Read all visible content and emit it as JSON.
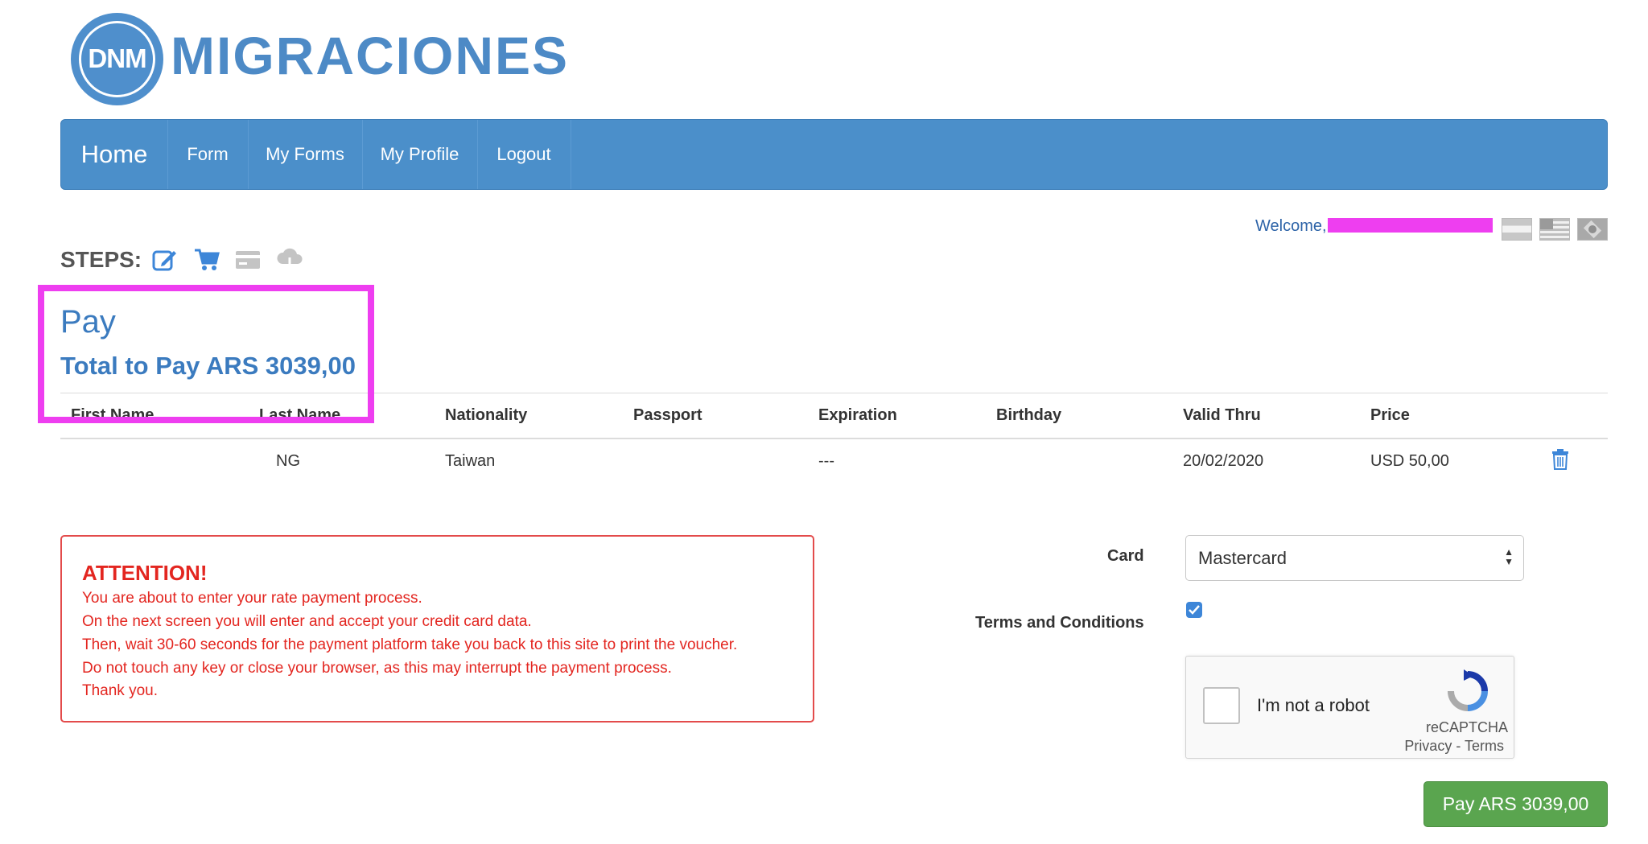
{
  "logo": {
    "abbr": "DNM",
    "name": "MIGRACIONES"
  },
  "nav": {
    "home": "Home",
    "form": "Form",
    "my_forms": "My Forms",
    "my_profile": "My Profile",
    "logout": "Logout"
  },
  "header": {
    "welcome": "Welcome,"
  },
  "steps": {
    "label": "STEPS:",
    "icons": [
      "edit-icon",
      "cart-icon",
      "credit-card-icon",
      "cloud-download-icon"
    ]
  },
  "pay": {
    "title": "Pay",
    "total": "Total to Pay ARS 3039,00"
  },
  "table": {
    "headers": [
      "First Name",
      "Last Name",
      "Nationality",
      "Passport",
      "Expiration",
      "Birthday",
      "Valid Thru",
      "Price"
    ],
    "row": {
      "first_name": "",
      "last_name": "NG",
      "nationality": "Taiwan",
      "passport": "",
      "expiration": "---",
      "birthday": "",
      "valid_thru": "20/02/2020",
      "price": "USD 50,00"
    }
  },
  "attention": {
    "title": "ATTENTION!",
    "lines": [
      "You are about to enter your rate payment process.",
      "On the next screen you will enter and accept your credit card data.",
      "Then, wait 30-60 seconds for the payment platform take you back to this site to print the voucher.",
      "Do not touch any key or close your browser, as this may interrupt the payment process.",
      "Thank you."
    ]
  },
  "form": {
    "card_label": "Card",
    "card_value": "Mastercard",
    "terms_label": "Terms and Conditions",
    "terms_checked": true
  },
  "captcha": {
    "text": "I'm not a robot",
    "brand": "reCAPTCHA",
    "links": "Privacy - Terms"
  },
  "pay_button": "Pay ARS 3039,00",
  "colors": {
    "nav": "#4b8fca",
    "title": "#3b7bbf",
    "attention": "#e32620",
    "pay_button": "#5aa54f",
    "highlight": "#ee3ef0"
  }
}
